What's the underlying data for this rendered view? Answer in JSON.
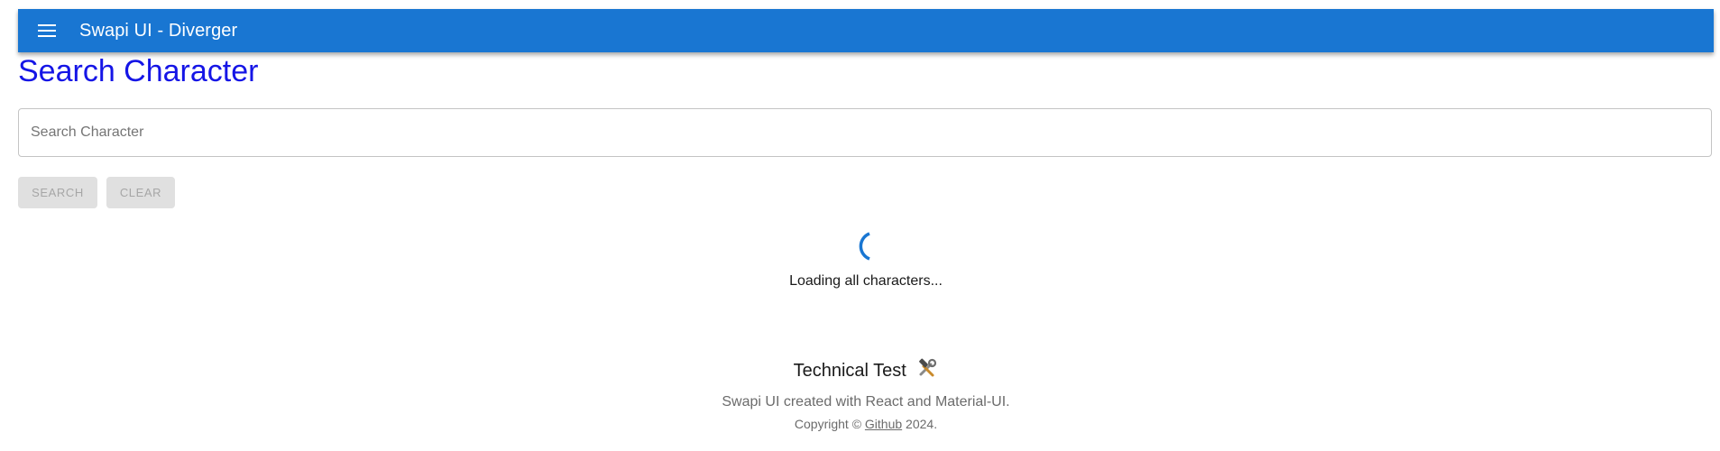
{
  "appbar": {
    "title": "Swapi UI - Diverger",
    "menu_icon": "hamburger-menu-icon",
    "background": "#1976d2"
  },
  "main": {
    "title": "Search Character",
    "title_color": "#1515e6",
    "search": {
      "placeholder": "Search Character",
      "value": ""
    },
    "buttons": {
      "search_label": "Search",
      "clear_label": "Clear"
    },
    "loading": {
      "text": "Loading all characters...",
      "spinner_color": "#1976d2"
    }
  },
  "footer": {
    "title": "Technical Test",
    "title_icon": "hammer-and-wrench-icon",
    "description": "Swapi UI created with React and Material-UI.",
    "copyright_prefix": "Copyright © ",
    "link_label": "Github",
    "copyright_suffix": " 2024."
  }
}
